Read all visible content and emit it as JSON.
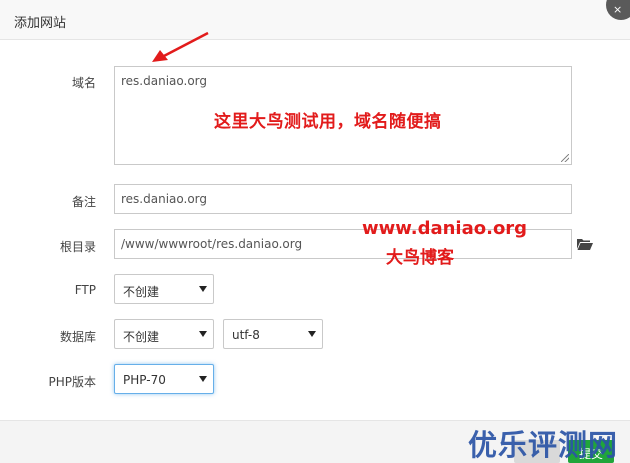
{
  "dialog": {
    "title": "添加网站",
    "close_icon": "×"
  },
  "form": {
    "domain_label": "域名",
    "domain_value": "res.daniao.org",
    "remark_label": "备注",
    "remark_value": "res.daniao.org",
    "root_label": "根目录",
    "root_value": "/www/wwwroot/res.daniao.org",
    "ftp_label": "FTP",
    "ftp_value": "不创建",
    "db_label": "数据库",
    "db_value": "不创建",
    "charset_value": "utf-8",
    "php_label": "PHP版本",
    "php_value": "PHP-70"
  },
  "annotations": {
    "main": "这里大鸟测试用，域名随便搞",
    "url": "www.daniao.org",
    "blog": "大鸟博客"
  },
  "footer": {
    "submit_label": "提交"
  },
  "watermark": "优乐评测网",
  "colors": {
    "annotation": "#e21b1b",
    "submit": "#20a53a",
    "watermark": "#2b54a6"
  }
}
